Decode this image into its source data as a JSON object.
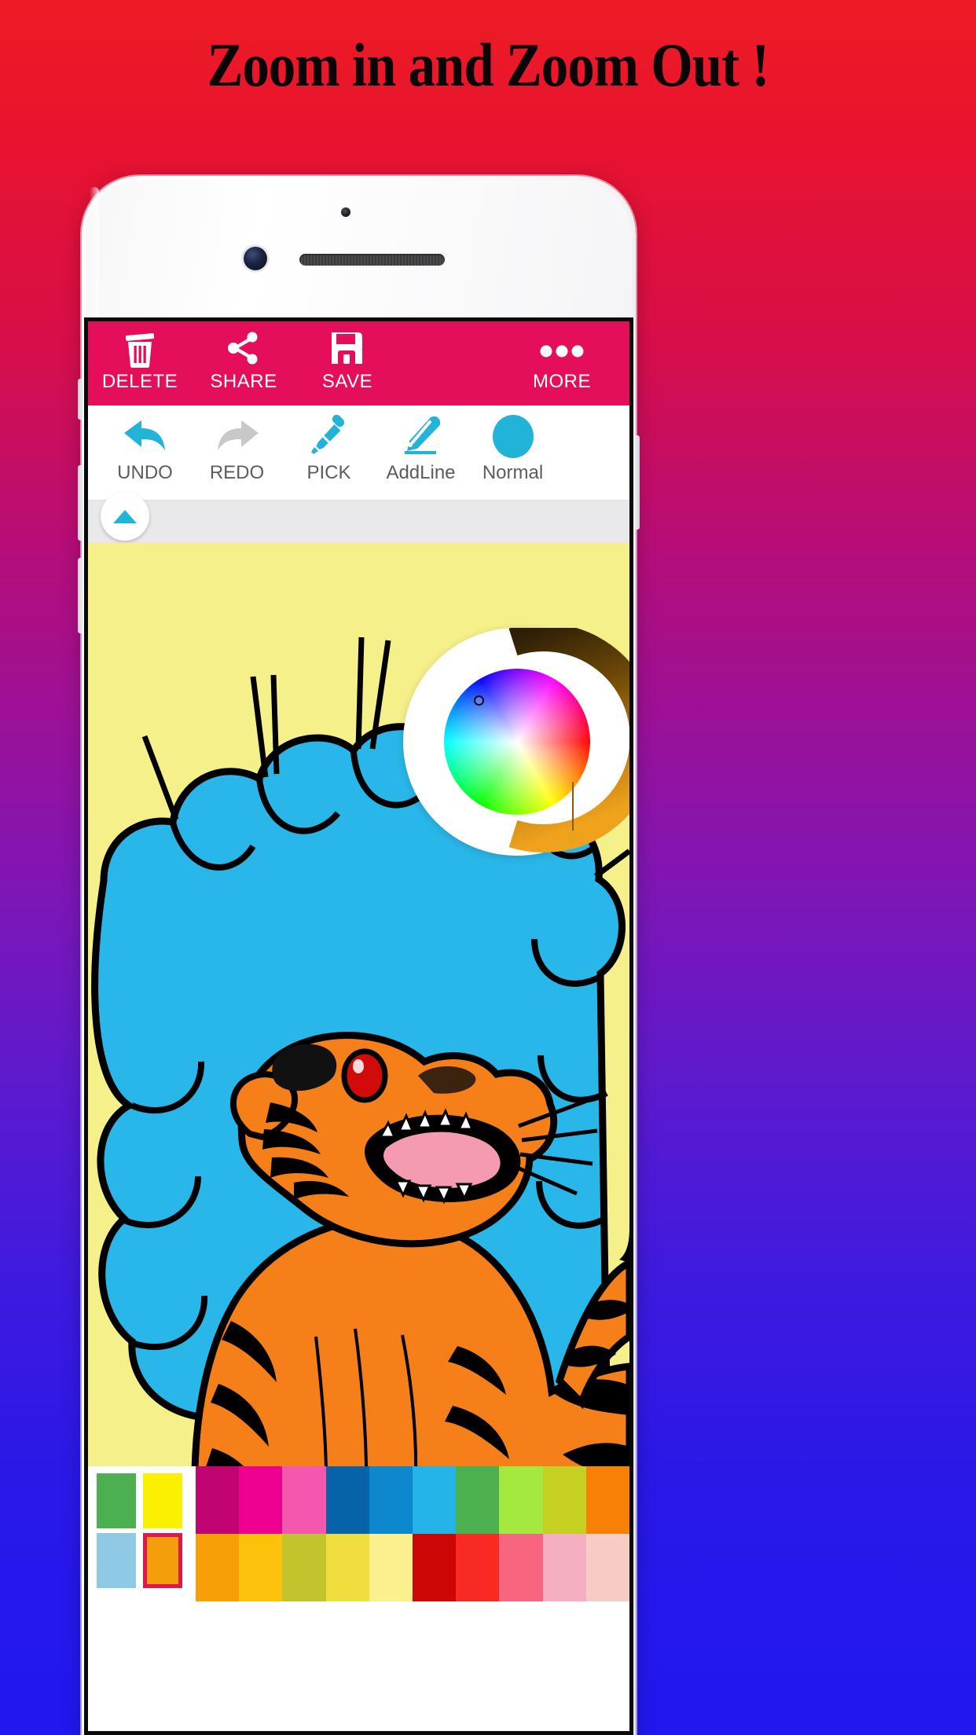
{
  "page": {
    "headline": "Zoom in and Zoom Out !",
    "background_top_color": "#ED1C24",
    "background_bottom_color": "#2018F0"
  },
  "device": {
    "frame_color": "#F4F4F6",
    "sensor": "proximity-sensor",
    "camera": "front-camera",
    "speaker": "earpiece-speaker"
  },
  "app": {
    "accent_pink": "#E50E5A",
    "accent_cyan": "#22B4D8",
    "action_bar": [
      {
        "id": "delete",
        "label": "DELETE",
        "icon": "trash-icon"
      },
      {
        "id": "share",
        "label": "SHARE",
        "icon": "share-icon"
      },
      {
        "id": "save",
        "label": "SAVE",
        "icon": "floppy-disk-icon"
      },
      {
        "id": "more",
        "label": "MORE",
        "icon": "ellipsis-icon"
      }
    ],
    "toolbar": [
      {
        "id": "undo",
        "label": "UNDO",
        "icon": "undo-arrow-icon",
        "state": "enabled",
        "color": "#22B4D8"
      },
      {
        "id": "redo",
        "label": "REDO",
        "icon": "redo-arrow-icon",
        "state": "disabled",
        "color": "#C8C8C8"
      },
      {
        "id": "pick",
        "label": "PICK",
        "icon": "eyedropper-icon",
        "state": "enabled",
        "color": "#22B4D8"
      },
      {
        "id": "addline",
        "label": "AddLine",
        "icon": "pencil-icon",
        "state": "enabled",
        "color": "#22B4D8"
      },
      {
        "id": "normal",
        "label": "Normal",
        "icon": "filled-circle-icon",
        "state": "enabled",
        "color": "#22B4D8"
      }
    ],
    "collapse_button": {
      "icon": "chevron-up-icon",
      "color": "#22B4D8"
    },
    "color_wheel": {
      "type": "hsv-disc",
      "selected_color": "#F0A21E",
      "cursor_position": "upper-left-orange",
      "brightness_arc_from": "#2E1E06",
      "brightness_arc_to": "#EFA21C"
    },
    "canvas": {
      "artwork": "roaring-tiger-coloring-page",
      "background_color": "#F6F08A",
      "cloud_color": "#29B6E8",
      "tiger_body_color": "#F57F18",
      "tiger_outline_color": "#000000",
      "tiger_eye_color": "#D10A0A",
      "tiger_mouth_color": "#F59BB0"
    },
    "palette": {
      "recent_colors": [
        "#4CAF50",
        "#FAF000",
        "#8ECAE6",
        "#F59E0B"
      ],
      "selected_recent_index": 3,
      "selection_border_color": "#E0174F",
      "row_1": [
        "#C1046F",
        "#EE0091",
        "#F357AE",
        "#0663A8",
        "#0D88CE",
        "#26B4E8",
        "#4CAF50",
        "#A5E840",
        "#C6D022",
        "#F98007"
      ],
      "row_2": [
        "#F89F07",
        "#FCC10A",
        "#C3C32E",
        "#F0DE3E",
        "#FAF08E",
        "#CC0505",
        "#F72B23",
        "#F7667E",
        "#F4AFC0",
        "#F7CCC4"
      ]
    }
  }
}
